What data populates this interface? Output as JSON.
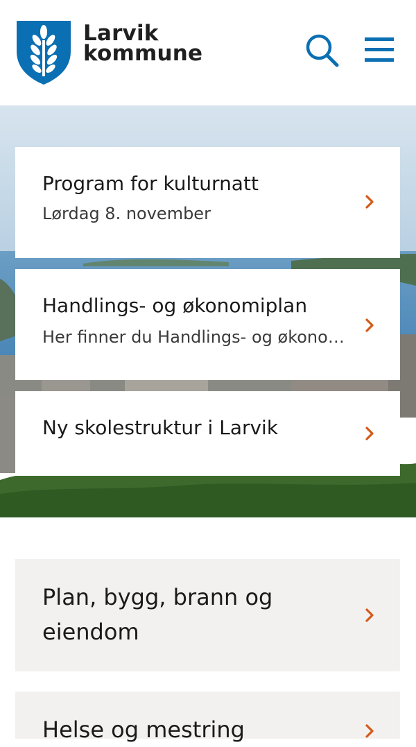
{
  "header": {
    "logo_line1": "Larvik",
    "logo_line2": "kommune"
  },
  "colors": {
    "brand_blue": "#0b6fb3",
    "chevron_orange": "#d45a1a",
    "category_bg": "#f2f1ef"
  },
  "icons": {
    "search": "search-icon",
    "menu": "hamburger-menu-icon",
    "chevron": "chevron-right-icon",
    "logo": "larvik-shield-logo"
  },
  "featured": [
    {
      "title": "Program for kulturnatt",
      "subtitle": "Lørdag 8. november"
    },
    {
      "title": "Handlings- og økonomiplan",
      "subtitle": "Her finner du Handlings- og økonomiplanen"
    },
    {
      "title": "Ny skolestruktur i Larvik",
      "subtitle": ""
    }
  ],
  "categories": [
    {
      "label": "Plan, bygg, brann og eiendom"
    },
    {
      "label": "Helse og mestring"
    }
  ]
}
